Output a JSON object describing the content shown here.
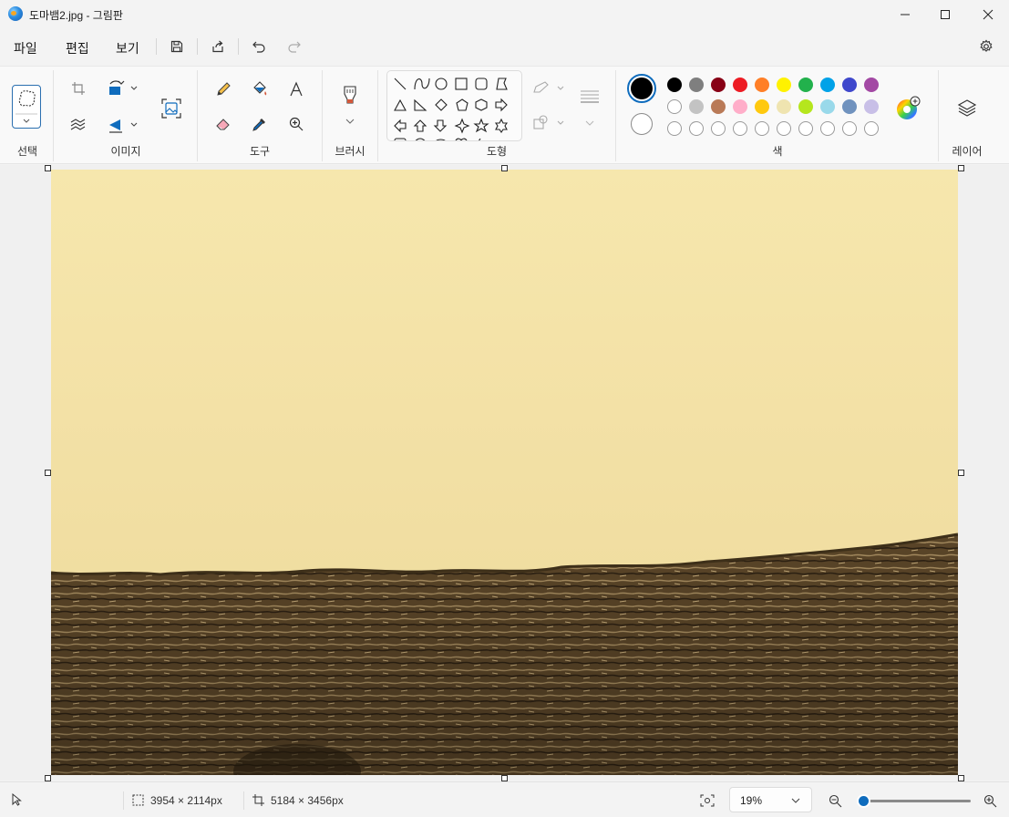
{
  "window": {
    "title": "도마뱀2.jpg - 그림판",
    "controls": [
      "minimize-icon",
      "maximize-icon",
      "close-icon"
    ]
  },
  "menu": {
    "file": "파일",
    "edit": "편집",
    "view": "보기"
  },
  "ribbon": {
    "groups": {
      "select": "선택",
      "image": "이미지",
      "tools": "도구",
      "brushes": "브러시",
      "shapes": "도형",
      "colors": "색",
      "layers": "레이어"
    },
    "colors": {
      "primary": "#000000",
      "secondary": "#ffffff",
      "palette_row1": [
        "#000000",
        "#7f7f7f",
        "#880015",
        "#ed1c24",
        "#ff7f27",
        "#fff200",
        "#22b14c",
        "#00a2e8",
        "#3f48cc",
        "#a349a4"
      ],
      "palette_row2": [
        "#ffffff",
        "#c3c3c3",
        "#b97a57",
        "#ffaec9",
        "#ffc90e",
        "#efe4b0",
        "#b5e61d",
        "#99d9ea",
        "#7092be",
        "#c8bfe7"
      ],
      "custom_slots": 10
    }
  },
  "status": {
    "selection_size": "3954 × 2114px",
    "image_size": "5184 × 3456px",
    "zoom": "19%",
    "zoom_level": 0.02
  }
}
